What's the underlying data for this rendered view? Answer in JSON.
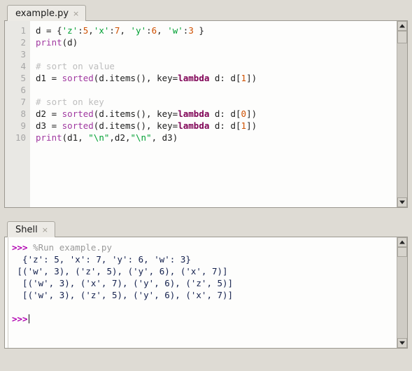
{
  "editor": {
    "tab": {
      "label": "example.py",
      "close_icon": "×"
    },
    "line_numbers": [
      "1",
      "2",
      "3",
      "4",
      "5",
      "6",
      "7",
      "8",
      "9",
      "10"
    ],
    "lines": [
      {
        "n": 1,
        "tokens": [
          {
            "t": "def",
            "v": "d = {"
          },
          {
            "t": "str",
            "v": "'z'"
          },
          {
            "t": "def",
            "v": ":"
          },
          {
            "t": "num",
            "v": "5"
          },
          {
            "t": "def",
            "v": ","
          },
          {
            "t": "str",
            "v": "'x'"
          },
          {
            "t": "def",
            "v": ":"
          },
          {
            "t": "num",
            "v": "7"
          },
          {
            "t": "def",
            "v": ", "
          },
          {
            "t": "str",
            "v": "'y'"
          },
          {
            "t": "def",
            "v": ":"
          },
          {
            "t": "num",
            "v": "6"
          },
          {
            "t": "def",
            "v": ", "
          },
          {
            "t": "str",
            "v": "'w'"
          },
          {
            "t": "def",
            "v": ":"
          },
          {
            "t": "num",
            "v": "3"
          },
          {
            "t": "def",
            "v": " }"
          }
        ]
      },
      {
        "n": 2,
        "tokens": [
          {
            "t": "bi",
            "v": "print"
          },
          {
            "t": "def",
            "v": "(d)"
          }
        ]
      },
      {
        "n": 3,
        "tokens": []
      },
      {
        "n": 4,
        "tokens": [
          {
            "t": "com",
            "v": "# sort on value"
          }
        ]
      },
      {
        "n": 5,
        "tokens": [
          {
            "t": "def",
            "v": "d1 = "
          },
          {
            "t": "bi",
            "v": "sorted"
          },
          {
            "t": "def",
            "v": "(d.items(), key="
          },
          {
            "t": "kw",
            "v": "lambda"
          },
          {
            "t": "def",
            "v": " d: d["
          },
          {
            "t": "num",
            "v": "1"
          },
          {
            "t": "def",
            "v": "])"
          }
        ]
      },
      {
        "n": 6,
        "tokens": []
      },
      {
        "n": 7,
        "tokens": [
          {
            "t": "com",
            "v": "# sort on key"
          }
        ]
      },
      {
        "n": 8,
        "tokens": [
          {
            "t": "def",
            "v": "d2 = "
          },
          {
            "t": "bi",
            "v": "sorted"
          },
          {
            "t": "def",
            "v": "(d.items(), key="
          },
          {
            "t": "kw",
            "v": "lambda"
          },
          {
            "t": "def",
            "v": " d: d["
          },
          {
            "t": "num",
            "v": "0"
          },
          {
            "t": "def",
            "v": "])"
          }
        ]
      },
      {
        "n": 9,
        "tokens": [
          {
            "t": "def",
            "v": "d3 = "
          },
          {
            "t": "bi",
            "v": "sorted"
          },
          {
            "t": "def",
            "v": "(d.items(), key="
          },
          {
            "t": "kw",
            "v": "lambda"
          },
          {
            "t": "def",
            "v": " d: d["
          },
          {
            "t": "num",
            "v": "1"
          },
          {
            "t": "def",
            "v": "])"
          }
        ]
      },
      {
        "n": 10,
        "tokens": [
          {
            "t": "bi",
            "v": "print"
          },
          {
            "t": "def",
            "v": "(d1, "
          },
          {
            "t": "str",
            "v": "\"\\n\""
          },
          {
            "t": "def",
            "v": ",d2,"
          },
          {
            "t": "str",
            "v": "\"\\n\""
          },
          {
            "t": "def",
            "v": ", d3)"
          }
        ]
      }
    ],
    "scrollbar": {
      "up_icon": "scroll-up-arrow",
      "down_icon": "scroll-down-arrow"
    }
  },
  "shell": {
    "tab": {
      "label": "Shell",
      "close_icon": "×"
    },
    "lines": [
      {
        "prompt": ">>>",
        "magic": " %Run example.py"
      },
      {
        "out": "  {'z': 5, 'x': 7, 'y': 6, 'w': 3}"
      },
      {
        "out": " [('w', 3), ('z', 5), ('y', 6), ('x', 7)]"
      },
      {
        "out": "  [('w', 3), ('x', 7), ('y', 6), ('z', 5)]"
      },
      {
        "out": "  [('w', 3), ('z', 5), ('y', 6), ('x', 7)]"
      },
      {
        "blank": " "
      },
      {
        "prompt": ">>>",
        "caret": true
      }
    ],
    "scrollbar": {
      "up_icon": "scroll-up-arrow",
      "down_icon": "scroll-down-arrow"
    }
  },
  "colors": {
    "window_bg": "#dedbd4",
    "pane_bg": "#fdfdfc",
    "gutter_bg": "#e9e8e4",
    "string": "#00a033",
    "number": "#cf5000",
    "builtin": "#a038a0",
    "keyword": "#7f0055",
    "comment": "#bdbdbd",
    "prompt": "#b000b0",
    "output": "#13204d"
  }
}
